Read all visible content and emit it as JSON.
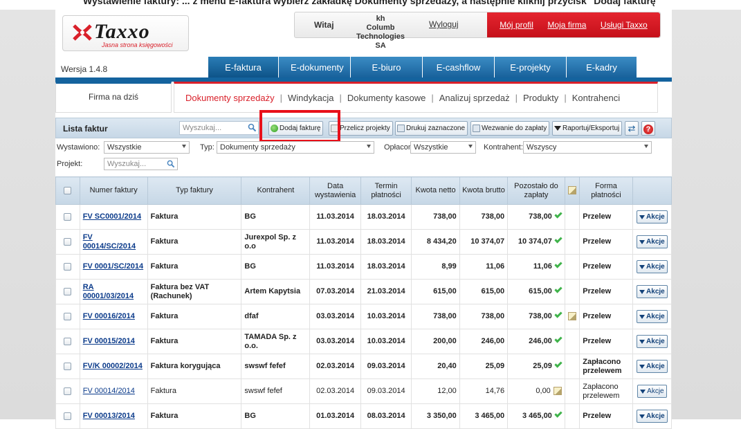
{
  "strip_text": "Wystawienie faktury: ... z menu E-faktura wybierz zakładkę Dokumenty sprzedaży, a następnie kliknij przycisk \"Dodaj fakturę\"",
  "logo": {
    "brand": "Taxxo",
    "tagline": "Jasna strona księgowości"
  },
  "user": {
    "greeting": "Witaj",
    "name": "kh",
    "company": "Columb Technologies SA",
    "logout": "Wyloguj"
  },
  "top_links": [
    "Mój profil",
    "Moja firma",
    "Usługi Taxxo"
  ],
  "version": "Wersja 1.4.8",
  "main_tabs": [
    "E-faktura",
    "E-dokumenty",
    "E-biuro",
    "E-cashflow",
    "E-projekty",
    "E-kadry"
  ],
  "firma": "Firma na dziś",
  "subnav": [
    "Dokumenty sprzedaży",
    "Windykacja",
    "Dokumenty kasowe",
    "Analizuj sprzedaż",
    "Produkty",
    "Kontrahenci"
  ],
  "toolbar": {
    "title": "Lista faktur",
    "search_placeholder": "Wyszukaj...",
    "add": "Dodaj fakturę",
    "recalc": "Przelicz projekty",
    "print": "Drukuj zaznaczone",
    "reminder": "Wezwanie do zapłaty",
    "report": "Raportuj/Eksportuj",
    "refresh_glyph": "⇄",
    "help_glyph": "?"
  },
  "filters": {
    "wystawiono_label": "Wystawiono:",
    "wystawiono": "Wszystkie",
    "typ_label": "Typ:",
    "typ": "Dokumenty sprzedaży",
    "oplacone_label": "Opłacone:",
    "oplacone": "Wszystkie",
    "kontrahent_label": "Kontrahent:",
    "kontrahent": "Wszyscy",
    "projekt_label": "Projekt:",
    "projekt_placeholder": "Wyszukaj..."
  },
  "table": {
    "headers": [
      "Numer faktury",
      "Typ faktury",
      "Kontrahent",
      "Data wystawienia",
      "Termin płatności",
      "Kwota netto",
      "Kwota brutto",
      "Pozostało do zapłaty",
      "Forma płatności"
    ],
    "rows": [
      {
        "nr": "FV SC0001/2014",
        "typ": "Faktura",
        "kontrahent": "BG",
        "data": "11.03.2014",
        "termin": "18.03.2014",
        "netto": "738,00",
        "brutto": "738,00",
        "pozostalo": "738,00",
        "forma": "Przelew",
        "akcje": "Akcje",
        "light": false,
        "pencil": false,
        "status_pencil": false
      },
      {
        "nr": "FV 00014/SC/2014",
        "typ": "Faktura",
        "kontrahent": "Jurexpol Sp. z o.o",
        "data": "11.03.2014",
        "termin": "18.03.2014",
        "netto": "8 434,20",
        "brutto": "10 374,07",
        "pozostalo": "10 374,07",
        "forma": "Przelew",
        "akcje": "Akcje",
        "light": false,
        "pencil": false,
        "status_pencil": false
      },
      {
        "nr": "FV 0001/SC/2014",
        "typ": "Faktura",
        "kontrahent": "BG",
        "data": "11.03.2014",
        "termin": "18.03.2014",
        "netto": "8,99",
        "brutto": "11,06",
        "pozostalo": "11,06",
        "forma": "Przelew",
        "akcje": "Akcje",
        "light": false,
        "pencil": false,
        "status_pencil": false
      },
      {
        "nr": "RA 00001/03/2014",
        "typ": "Faktura bez VAT (Rachunek)",
        "kontrahent": "Artem Kapytsia",
        "data": "07.03.2014",
        "termin": "21.03.2014",
        "netto": "615,00",
        "brutto": "615,00",
        "pozostalo": "615,00",
        "forma": "Przelew",
        "akcje": "Akcje",
        "light": false,
        "pencil": false,
        "status_pencil": false
      },
      {
        "nr": "FV 00016/2014",
        "typ": "Faktura",
        "kontrahent": "dfaf",
        "data": "03.03.2014",
        "termin": "10.03.2014",
        "netto": "738,00",
        "brutto": "738,00",
        "pozostalo": "738,00",
        "forma": "Przelew",
        "akcje": "Akcje",
        "light": false,
        "pencil": true,
        "status_pencil": false
      },
      {
        "nr": "FV 00015/2014",
        "typ": "Faktura",
        "kontrahent": "TAMADA Sp. z o.o.",
        "data": "03.03.2014",
        "termin": "10.03.2014",
        "netto": "200,00",
        "brutto": "246,00",
        "pozostalo": "246,00",
        "forma": "Przelew",
        "akcje": "Akcje",
        "light": false,
        "pencil": false,
        "status_pencil": false
      },
      {
        "nr": "FV/K 00002/2014",
        "typ": "Faktura korygująca",
        "kontrahent": "swswf fefef",
        "data": "02.03.2014",
        "termin": "09.03.2014",
        "netto": "20,40",
        "brutto": "25,09",
        "pozostalo": "25,09",
        "forma": "Zapłacono przelewem",
        "akcje": "Akcje",
        "light": false,
        "pencil": false,
        "status_pencil": false
      },
      {
        "nr": "FV 00014/2014",
        "typ": "Faktura",
        "kontrahent": "swswf fefef",
        "data": "02.03.2014",
        "termin": "09.03.2014",
        "netto": "12,00",
        "brutto": "14,76",
        "pozostalo": "0,00",
        "forma": "Zapłacono przelewem",
        "akcje": "Akcje",
        "light": true,
        "pencil": false,
        "status_pencil": true
      },
      {
        "nr": "FV 00013/2014",
        "typ": "Faktura",
        "kontrahent": "BG",
        "data": "01.03.2014",
        "termin": "08.03.2014",
        "netto": "3 350,00",
        "brutto": "3 465,00",
        "pozostalo": "3 465,00",
        "forma": "Przelew",
        "akcje": "Akcje",
        "light": false,
        "pencil": false,
        "status_pencil": false
      }
    ]
  }
}
